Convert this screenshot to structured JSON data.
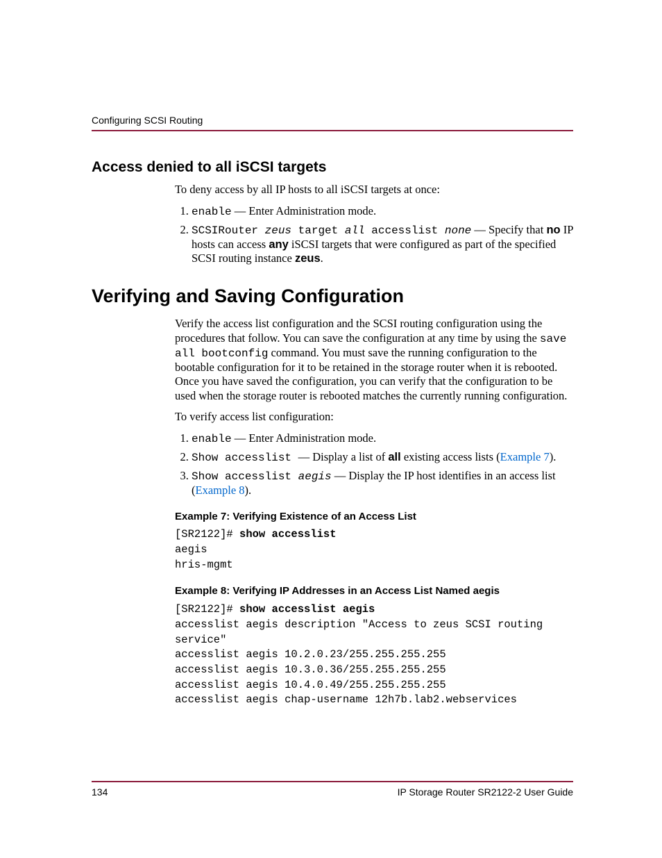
{
  "running_head": "Configuring SCSI Routing",
  "sect1": {
    "title": "Access denied to all iSCSI targets",
    "intro": "To deny access by all IP hosts to all iSCSI targets at once:",
    "step1_cmd": "enable",
    "step1_rest": " — Enter Administration mode.",
    "step2_c1": "SCSIRouter ",
    "step2_i1": "zeus",
    "step2_c2": " target ",
    "step2_i2": "all",
    "step2_c3": " accesslist ",
    "step2_i3": "none",
    "step2_dash": " — Specify that ",
    "step2_no": "no",
    "step2_mid": " IP hosts can access ",
    "step2_any": "any",
    "step2_rest": " iSCSI targets that were configured as part of the specified SCSI routing instance ",
    "step2_zeus": "zeus",
    "step2_period": "."
  },
  "sect2": {
    "title": "Verifying and Saving Configuration",
    "p1a": "Verify the access list configuration and the SCSI routing configuration using the procedures that follow. You can save the configuration at any time by using the ",
    "p1_cmd": "save all bootconfig",
    "p1b": " command. You must save the running configuration to the bootable configuration for it to be retained in the storage router when it is rebooted. Once you have saved the configuration, you can verify that the configuration to be used when the storage router is rebooted matches the currently running configuration.",
    "p2": "To verify access list configuration:",
    "s1_cmd": "enable",
    "s1_rest": " — Enter Administration mode.",
    "s2_cmd": "Show accesslist ",
    "s2_rest1": " — Display a list of ",
    "s2_all": "all",
    "s2_rest2": " existing access lists (",
    "s2_link": "Example 7",
    "s2_close": ").",
    "s3_cmd": "Show accesslist ",
    "s3_it": "aegis",
    "s3_dash": " — ",
    "s3_rest": "Display the IP host identifies in an access list (",
    "s3_link": "Example 8",
    "s3_close": ")."
  },
  "ex7": {
    "title": "Example 7:  Verifying Existence of an Access List",
    "prompt": "[SR2122]# ",
    "cmd": "show accesslist",
    "out1": "aegis",
    "out2": "hris-mgmt"
  },
  "ex8": {
    "title": "Example 8:  Verifying IP Addresses in an Access List Named aegis",
    "prompt": "[SR2122]# ",
    "cmd": "show accesslist aegis",
    "l1": "accesslist aegis description \"Access to zeus SCSI routing",
    "l1b": "service\"",
    "l2": "accesslist aegis 10.2.0.23/255.255.255.255",
    "l3": "accesslist aegis 10.3.0.36/255.255.255.255",
    "l4": "accesslist aegis 10.4.0.49/255.255.255.255",
    "l5": "accesslist aegis chap-username 12h7b.lab2.webservices"
  },
  "footer": {
    "page": "134",
    "title": "IP Storage Router SR2122-2 User Guide"
  }
}
